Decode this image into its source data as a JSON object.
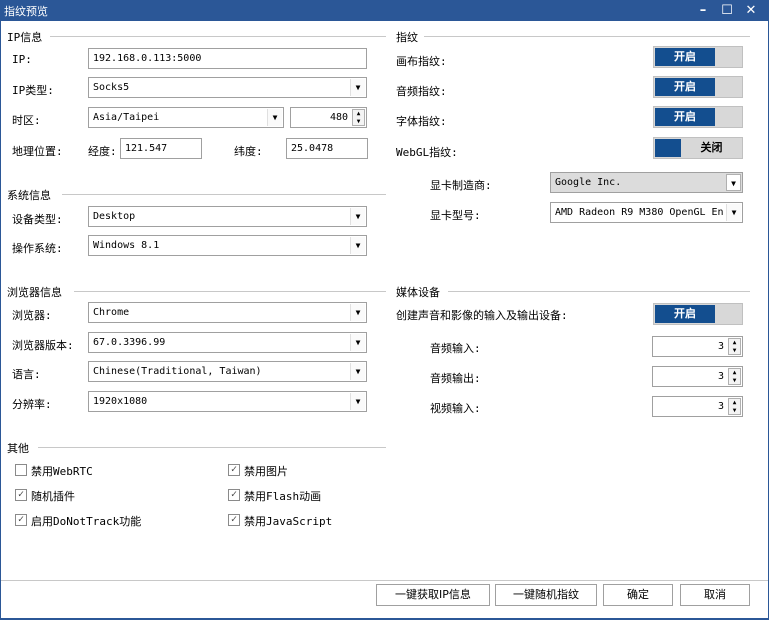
{
  "window": {
    "title": "指纹预览",
    "minimize": "–",
    "maximize": "☐",
    "close": "✕"
  },
  "ip_info": {
    "title": "IP信息",
    "ip_label": "IP:",
    "ip_value": "192.168.0.113:5000",
    "type_label": "IP类型:",
    "type_value": "Socks5",
    "timezone_label": "时区:",
    "timezone_value": "Asia/Taipei",
    "timezone_offset": "480",
    "geo_label": "地理位置:",
    "lng_label": "经度:",
    "lng_value": "121.547",
    "lat_label": "纬度:",
    "lat_value": "25.0478"
  },
  "system_info": {
    "title": "系统信息",
    "device_label": "设备类型:",
    "device_value": "Desktop",
    "os_label": "操作系统:",
    "os_value": "Windows 8.1"
  },
  "browser_info": {
    "title": "浏览器信息",
    "browser_label": "浏览器:",
    "browser_value": "Chrome",
    "version_label": "浏览器版本:",
    "version_value": "67.0.3396.99",
    "lang_label": "语言:",
    "lang_value": "Chinese(Traditional, Taiwan)",
    "res_label": "分辨率:",
    "res_value": "1920x1080"
  },
  "other": {
    "title": "其他",
    "items": [
      {
        "label": "禁用WebRTC",
        "checked": false
      },
      {
        "label": "禁用图片",
        "checked": true
      },
      {
        "label": "随机插件",
        "checked": true
      },
      {
        "label": "禁用Flash动画",
        "checked": true
      },
      {
        "label": "启用DoNotTrack功能",
        "checked": true
      },
      {
        "label": "禁用JavaScript",
        "checked": true
      }
    ]
  },
  "fingerprint": {
    "title": "指纹",
    "canvas_label": "画布指纹:",
    "canvas_state": "开启",
    "audio_label": "音频指纹:",
    "audio_state": "开启",
    "font_label": "字体指纹:",
    "font_state": "开启",
    "webgl_label": "WebGL指纹:",
    "webgl_state": "关闭",
    "vendor_label": "显卡制造商:",
    "vendor_value": "Google Inc.",
    "model_label": "显卡型号:",
    "model_value": "AMD Radeon R9 M380 OpenGL En"
  },
  "media": {
    "title": "媒体设备",
    "create_label": "创建声音和影像的输入及输出设备:",
    "create_state": "开启",
    "audio_in_label": "音频输入:",
    "audio_in_value": "3",
    "audio_out_label": "音频输出:",
    "audio_out_value": "3",
    "video_in_label": "视频输入:",
    "video_in_value": "3"
  },
  "footer": {
    "get_ip": "一键获取IP信息",
    "random_fp": "一键随机指纹",
    "ok": "确定",
    "cancel": "取消"
  },
  "icons": {
    "dropdown": "▼",
    "spin_up": "▲",
    "spin_down": "▼",
    "check": "✓"
  },
  "colors": {
    "title_bar": "#2b5797",
    "toggle_on": "#134e8f",
    "toggle_track": "#d8d8d8"
  }
}
